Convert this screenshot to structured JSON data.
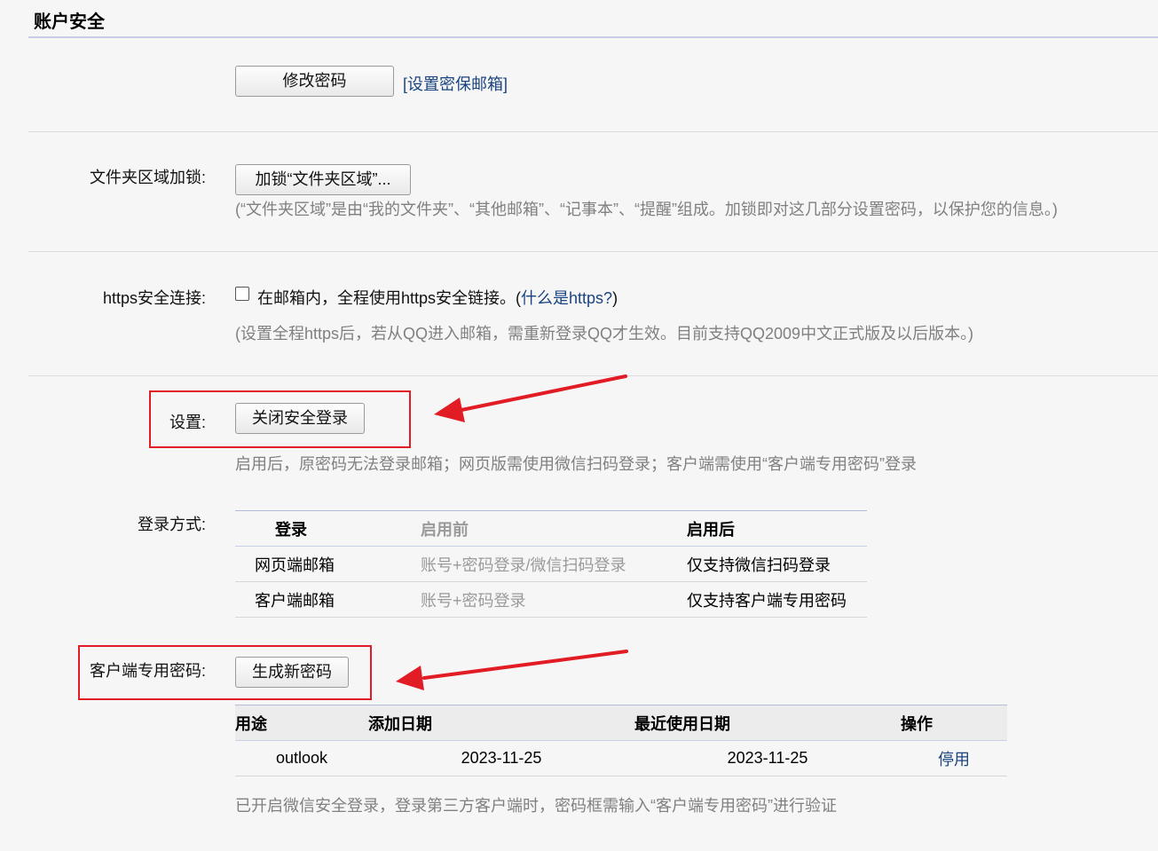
{
  "page": {
    "title": "账户安全"
  },
  "password": {
    "change_button": "修改密码",
    "set_email_link": "[设置密保邮箱]"
  },
  "folder_lock": {
    "label": "文件夹区域加锁:",
    "button": "加锁“文件夹区域”...",
    "hint": "(“文件夹区域”是由“我的文件夹”、“其他邮箱”、“记事本”、“提醒”组成。加锁即对这几部分设置密码，以保护您的信息。)"
  },
  "https": {
    "label": "https安全连接:",
    "checkbox_text": "在邮箱内，全程使用https安全链接。(",
    "what_link": "什么是https?",
    "close_paren": ")",
    "checked": false,
    "hint": "(设置全程https后，若从QQ进入邮箱，需重新登录QQ才生效。目前支持QQ2009中文正式版及以后版本。)"
  },
  "secure_login": {
    "label": "设置:",
    "button": "关闭安全登录",
    "hint": "启用后，原密码无法登录邮箱；网页版需使用微信扫码登录；客户端需使用“客户端专用密码”登录"
  },
  "login_methods": {
    "label": "登录方式:",
    "headers": [
      "登录",
      "启用前",
      "启用后"
    ],
    "rows": [
      [
        "网页端邮箱",
        "账号+密码登录/微信扫码登录",
        "仅支持微信扫码登录"
      ],
      [
        "客户端邮箱",
        "账号+密码登录",
        "仅支持客户端专用密码"
      ]
    ]
  },
  "client_password": {
    "label": "客户端专用密码:",
    "button": "生成新密码",
    "headers": [
      "用途",
      "添加日期",
      "最近使用日期",
      "操作"
    ],
    "rows": [
      {
        "purpose": "outlook",
        "added": "2023-11-25",
        "last_used": "2023-11-25",
        "action": "停用"
      }
    ],
    "hint": "已开启微信安全登录，登录第三方客户端时，密码框需输入“客户端专用密码”进行验证"
  },
  "colors": {
    "annotation": "#e21c24",
    "link": "#1a4480",
    "hint": "#808080"
  }
}
